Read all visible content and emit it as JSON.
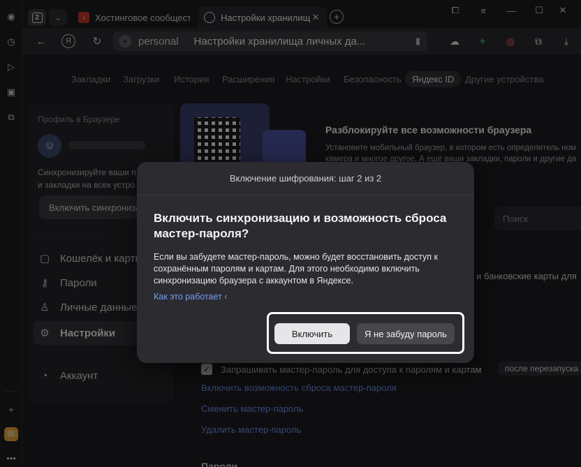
{
  "tabs": {
    "count": "2",
    "inactive_title": "Хостинговое сообщество",
    "active_title": "Настройки хранилища",
    "close_glyph": "✕",
    "new_tab_glyph": "+"
  },
  "address": {
    "domain": "personal",
    "page_title": "Настройки хранилища личных да..."
  },
  "menu": {
    "items": [
      "Закладки",
      "Загрузки",
      "История",
      "Расширения",
      "Настройки",
      "Безопасность",
      "Яндекс ID",
      "Другие устройства"
    ],
    "selected": "Яндекс ID"
  },
  "sidebar": {
    "profile_caption": "Профиль в Браузере",
    "sync_text_1": "Синхронизируйте ваши п",
    "sync_text_2": "и закладки на всех устро",
    "sync_button": "Включить синхронизац",
    "items": [
      "Кошелёк и карты",
      "Пароли",
      "Личные данные",
      "Настройки",
      "Аккаунт"
    ],
    "active_item": "Настройки"
  },
  "promo": {
    "title": "Разблокируйте все возможности браузера",
    "line1": "Установите мобильный браузер, в котором есть определитель ном",
    "line2": "камера и многое другое. А ещё ваши закладки, пароли и другие да"
  },
  "content": {
    "search_placeholder": "Поиск",
    "cards_line": "и банковские карты для",
    "checkbox_label": "Запрашивать мастер-пароль для доступа к паролям и картам",
    "restart_pill": "после перезапуска",
    "links": [
      "Включить возможность сброса мастер-пароля",
      "Сменить мастер-пароль",
      "Удалить мастер-пароль"
    ],
    "section_title": "Пароли"
  },
  "dialog": {
    "step": "Включение шифрования: шаг 2 из 2",
    "title": "Включить синхронизацию и возможность сброса мастер-пароля?",
    "body": "Если вы забудете мастер-пароль, можно будет восстановить доступ к сохранённым паролям и картам. Для этого необходимо включить синхронизацию браузера с аккаунтом в Яндексе.",
    "how_link": "Как это работает",
    "enable_button": "Включить",
    "decline_button": "Я не забуду пароль"
  },
  "colors": {
    "accent_link": "#6c8fe6",
    "highlight_frame": "#ffffff",
    "promo_card": "#3b3f6f"
  }
}
